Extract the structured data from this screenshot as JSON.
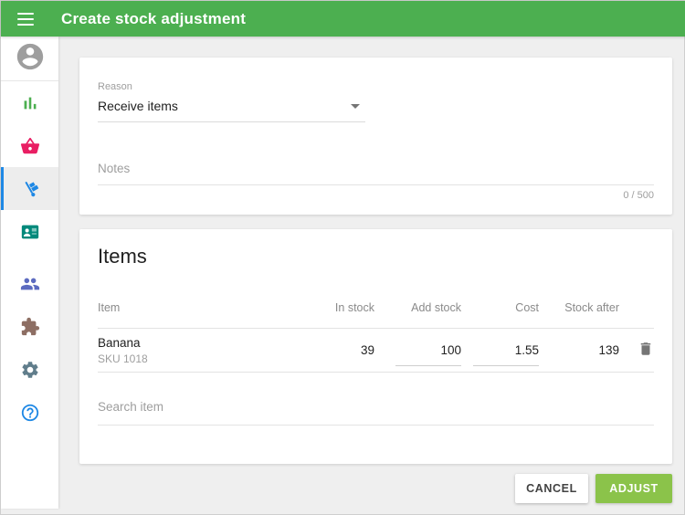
{
  "header": {
    "title": "Create stock adjustment"
  },
  "sidebar": {
    "icons": [
      "account",
      "reports",
      "items",
      "inventory",
      "customers",
      "employees",
      "apps",
      "settings",
      "help"
    ],
    "active_item": "inventory"
  },
  "form": {
    "reason_label": "Reason",
    "reason_value": "Receive items",
    "notes_placeholder": "Notes",
    "notes_counter": "0 / 500"
  },
  "items": {
    "title": "Items",
    "columns": [
      "Item",
      "In stock",
      "Add stock",
      "Cost",
      "Stock after"
    ],
    "rows": [
      {
        "name": "Banana",
        "sku": "SKU 1018",
        "in_stock": "39",
        "add_stock": "100",
        "cost": "1.55",
        "stock_after": "139"
      }
    ],
    "search_placeholder": "Search item"
  },
  "actions": {
    "cancel": "CANCEL",
    "adjust": "ADJUST"
  },
  "colors": {
    "header_green": "#4CAF50",
    "adjust_green": "#8BC34A",
    "active_blue": "#1E88E5",
    "reports_green": "#4CAF50",
    "items_pink": "#E91E63",
    "customers_teal": "#00897B",
    "employees_indigo": "#5C6BC0",
    "apps_brown": "#8D6E63",
    "settings_bluegray": "#607D8B"
  }
}
